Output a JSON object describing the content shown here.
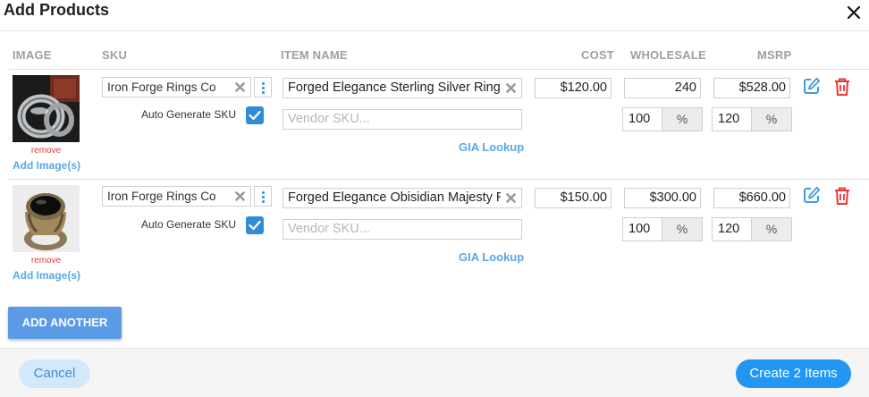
{
  "dialog": {
    "title": "Add Products"
  },
  "columns": {
    "image": "IMAGE",
    "sku": "SKU",
    "item_name": "ITEM NAME",
    "cost": "COST",
    "wholesale": "WHOLESALE",
    "msrp": "MSRP"
  },
  "products": [
    {
      "sku": "Iron Forge Rings Co",
      "auto_generate_label": "Auto Generate SKU",
      "auto_generate_checked": true,
      "item_name": "Forged Elegance Sterling Silver Ring",
      "vendor_sku_placeholder": "Vendor SKU...",
      "gia_lookup": "GIA Lookup",
      "cost": "$120.00",
      "wholesale": "240",
      "msrp": "$528.00",
      "wholesale_pct": "100",
      "msrp_pct": "120",
      "pct_symbol": "%",
      "remove_label": "remove",
      "add_images_label": "Add Image(s)"
    },
    {
      "sku": "Iron Forge Rings Co",
      "auto_generate_label": "Auto Generate SKU",
      "auto_generate_checked": true,
      "item_name": "Forged Elegance Obisidian Majesty Ring",
      "vendor_sku_placeholder": "Vendor SKU...",
      "gia_lookup": "GIA Lookup",
      "cost": "$150.00",
      "wholesale": "$300.00",
      "msrp": "$660.00",
      "wholesale_pct": "100",
      "msrp_pct": "120",
      "pct_symbol": "%",
      "remove_label": "remove",
      "add_images_label": "Add Image(s)"
    }
  ],
  "actions": {
    "add_another": "ADD ANOTHER",
    "cancel": "Cancel",
    "create": "Create 2 Items"
  },
  "icons": {
    "close": "close-icon",
    "clear": "clear-x-icon",
    "more": "kebab-menu-icon",
    "check": "checkmark-icon",
    "edit": "edit-icon",
    "delete": "trash-icon"
  },
  "colors": {
    "accent": "#2196f3",
    "link": "#5aa7e6",
    "danger": "#e53935",
    "checkbox": "#2f8cd8"
  }
}
